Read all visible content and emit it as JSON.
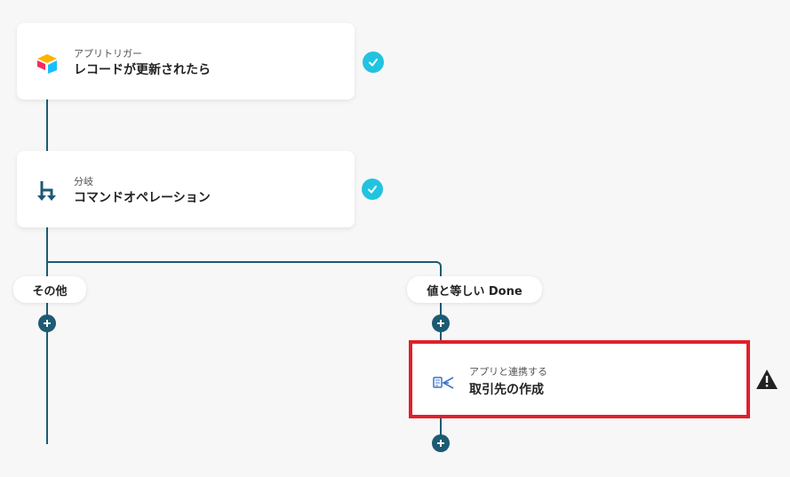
{
  "flow": {
    "trigger": {
      "subtitle": "アプリトリガー",
      "title": "レコードが更新されたら",
      "icon": "airtable-icon"
    },
    "branch": {
      "subtitle": "分岐",
      "title": "コマンドオペレーション",
      "icon": "branch-icon"
    },
    "branch_labels": {
      "other": "その他",
      "equals": "値と等しい Done"
    },
    "action": {
      "subtitle": "アプリと連携する",
      "title": "取引先の作成",
      "icon": "app-connect-icon"
    }
  },
  "colors": {
    "connector": "#1c5b73",
    "check": "#22c3e0",
    "highlight_border": "#e0202a",
    "warning": "#222222"
  },
  "icons": {
    "check": "check-icon",
    "plus": "plus-icon",
    "warning": "warning-triangle-icon"
  }
}
